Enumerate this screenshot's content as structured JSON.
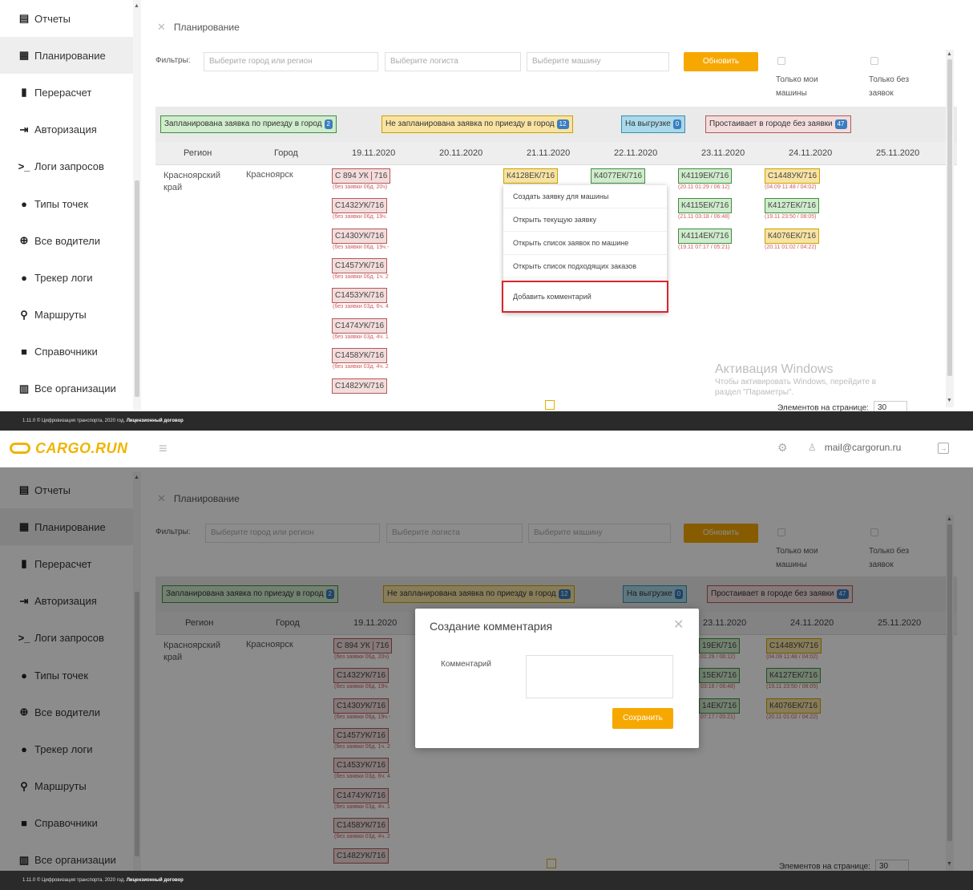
{
  "header": {
    "logo_text": "CARGO.RUN",
    "user_email": "mail@cargorun.ru"
  },
  "sidebar": {
    "items": [
      {
        "label": "Отчеты",
        "icon": "report-icon"
      },
      {
        "label": "Планирование",
        "icon": "planning-icon"
      },
      {
        "label": "Перерасчет",
        "icon": "recalc-icon"
      },
      {
        "label": "Авторизация",
        "icon": "login-icon"
      },
      {
        "label": "Логи запросов",
        "icon": "terminal-icon"
      },
      {
        "label": "Типы точек",
        "icon": "map-marker-icon"
      },
      {
        "label": "Все водители",
        "icon": "globe-icon"
      },
      {
        "label": "Трекер логи",
        "icon": "map-marker-icon"
      },
      {
        "label": "Маршруты",
        "icon": "route-icon"
      },
      {
        "label": "Справочники",
        "icon": "book-icon"
      },
      {
        "label": "Все организации",
        "icon": "building-icon"
      }
    ],
    "active_index": 1
  },
  "footer": {
    "text": "1.11.0 © Цифровизация транспорта, 2020 год.",
    "link": "Лицензионный договор"
  },
  "page": {
    "breadcrumb": "Планирование",
    "filters_label": "Фильтры:",
    "city_placeholder": "Выберите город или регион",
    "logist_placeholder": "Выберите логиста",
    "truck_placeholder": "Выберите машину",
    "refresh_button": "Обновить",
    "only_my_trucks": [
      "Только мои",
      "машины"
    ],
    "only_without_orders": [
      "Только без",
      "заявок"
    ]
  },
  "legend": [
    {
      "label": "Запланирована заявка по приезду в город",
      "count": "2",
      "bg": "#cfeccc",
      "border": "#3f8f3f"
    },
    {
      "label": "Не запланирована заявка по приезду в город",
      "count": "12",
      "bg": "#f8e3a3",
      "border": "#c9a200"
    },
    {
      "label": "На выгрузке",
      "count": "0",
      "bg": "#a9d9ea",
      "border": "#3a8fb0"
    },
    {
      "label": "Простаивает в городе без заявки",
      "count": "47",
      "bg": "#f3dcdc",
      "border": "#b25a5a"
    }
  ],
  "grid": {
    "columns": [
      "Регион",
      "Город",
      "19.11.2020",
      "20.11.2020",
      "21.11.2020",
      "22.11.2020",
      "23.11.2020",
      "24.11.2020",
      "25.11.2020"
    ],
    "region": "Красноярский край",
    "city": "Красноярск",
    "col_19": [
      {
        "plate": "С 894 УК",
        "code": "716",
        "sub": "(без заявки 06д. 20ч)"
      },
      {
        "plate": "С1432УК/716",
        "sub": "(без заявки 06д. 19ч."
      },
      {
        "plate": "С1430УК/716",
        "sub": "(без заявки 06д. 19ч.-"
      },
      {
        "plate": "С1457УК/716",
        "sub": "(без заявки 06д. 1ч. 2"
      },
      {
        "plate": "С1453УК/716",
        "sub": "(без заявки 03д. 6ч. 4"
      },
      {
        "plate": "С1474УК/716",
        "sub": "(без заявки 03д. 4ч. 1"
      },
      {
        "plate": "С1458УК/716",
        "sub": "(без заявки 03д. 4ч. 2"
      },
      {
        "plate": "С1482УК/716",
        "sub": ""
      }
    ],
    "col_21": [
      {
        "plate": "К4128ЕК/716"
      }
    ],
    "col_22": [
      {
        "plate": "К4077ЕК/716"
      }
    ],
    "col_23": [
      {
        "plate": "К4119ЕК/716",
        "sub": "(20.11 01:29 / 06:12)"
      },
      {
        "plate": "К4115ЕК/716",
        "sub": "(21.11 03:18 / 06:48)"
      },
      {
        "plate": "К4114ЕК/716",
        "sub": "(19.11 07:17 / 05:21)"
      }
    ],
    "col_24": [
      {
        "plate": "С1448УК/716",
        "sub": "(04.09 11:48 / 04:02)"
      },
      {
        "plate": "К4127ЕК/716",
        "sub": "(19.11 23:50 / 08:05)"
      },
      {
        "plate": "К4076ЕК/716",
        "sub": "(20.11 01:02 / 04:22)"
      }
    ],
    "col_23_clipped": [
      {
        "plate": "19ЕК/716",
        "sub": "01:29 / 06:12)"
      },
      {
        "plate": "15ЕК/716",
        "sub": "03:18 / 06:48)"
      },
      {
        "plate": "14ЕК/716",
        "sub": "07:17 / 05:21)"
      }
    ],
    "per_page_label": "Элементов на странице:",
    "per_page_value": "30"
  },
  "context_menu": {
    "items": [
      "Создать заявку для машины",
      "Открыть текущую заявку",
      "Открыть список заявок по машине",
      "Открыть список подходящих заказов",
      "Добавить комментарий"
    ],
    "highlighted_index": 4
  },
  "watermark": {
    "title": "Активация Windows",
    "line1": "Чтобы активировать Windows, перейдите в",
    "line2": "раздел \"Параметры\"."
  },
  "modal": {
    "title": "Создание комментария",
    "field_label": "Комментарий",
    "save_button": "Сохранить"
  }
}
